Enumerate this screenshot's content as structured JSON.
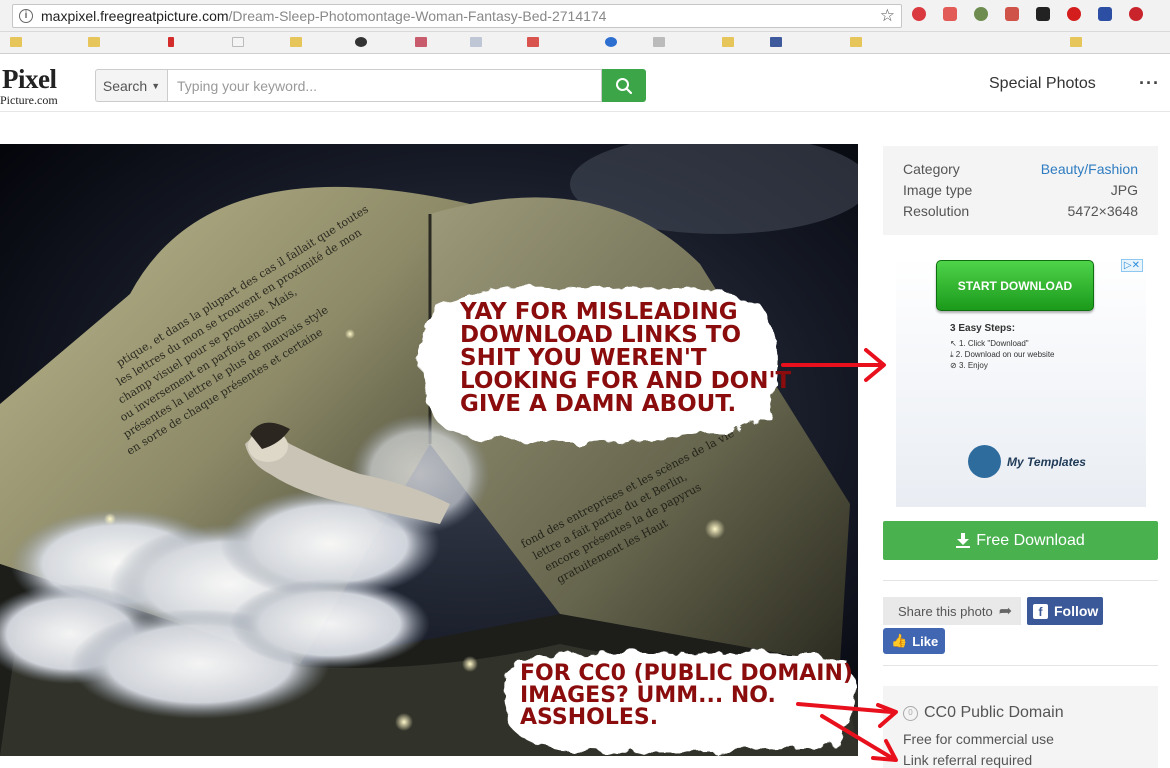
{
  "browser": {
    "url_domain": "maxpixel.freegreatpicture.com",
    "url_path": "/Dream-Sleep-Photomontage-Woman-Fantasy-Bed-2714174"
  },
  "site": {
    "logo_top": "Pixel",
    "logo_bottom": "Picture.com",
    "search_dropdown": "Search",
    "search_placeholder": "Typing your keyword...",
    "nav_special": "Special Photos",
    "more": "···"
  },
  "photo": {
    "page_lines_1": [
      "ptique, et dans la plupart des cas il fallait que toutes",
      "les lettres du mon  se trouvent en proximité de mon",
      "champ visuel pour se produise. Mais,",
      "ou inversement en parfois en  alors",
      "présentes la lettre  le plus de  mauvais style",
      "en sorte de chaque  présentes et  certaine"
    ],
    "page_lines_2": [
      "fond des entreprises et les scènes de la vie",
      "lettre a fait partie du  et  Berlin,",
      "encore  présentes la  de  papyrus",
      "gratuitement  les  Haut  "
    ],
    "callout_1": "YAY FOR MISLEADING\nDOWNLOAD LINKS TO\nSHIT YOU WEREN'T\nLOOKING FOR AND DON'T\nGIVE A DAMN ABOUT.",
    "callout_2": "FOR CC0 (PUBLIC DOMAIN)\nIMAGES? UMM... NO.\nASSHOLES."
  },
  "info": {
    "rows": [
      {
        "label": "Category",
        "value": "Beauty/Fashion"
      },
      {
        "label": "Image type",
        "value": "JPG"
      },
      {
        "label": "Resolution",
        "value": "5472×3648"
      }
    ]
  },
  "ad": {
    "button": "START DOWNLOAD",
    "steps_title": "3 Easy Steps:",
    "steps": [
      "1. Click \"Download\"",
      "2. Download on our website",
      "3. Enjoy"
    ],
    "brand": "My Templates"
  },
  "actions": {
    "free_download": "Free Download",
    "share": "Share this photo",
    "follow": "Follow",
    "like": "Like"
  },
  "license": {
    "title": "CC0 Public Domain",
    "line1": "Free for commercial use",
    "line2": "Link referral required"
  },
  "colors": {
    "green": "#4ab14f",
    "facebook": "#3b5998",
    "link": "#2e7cc1",
    "callout_text": "#8b0c0c",
    "arrow": "#e8101c"
  }
}
